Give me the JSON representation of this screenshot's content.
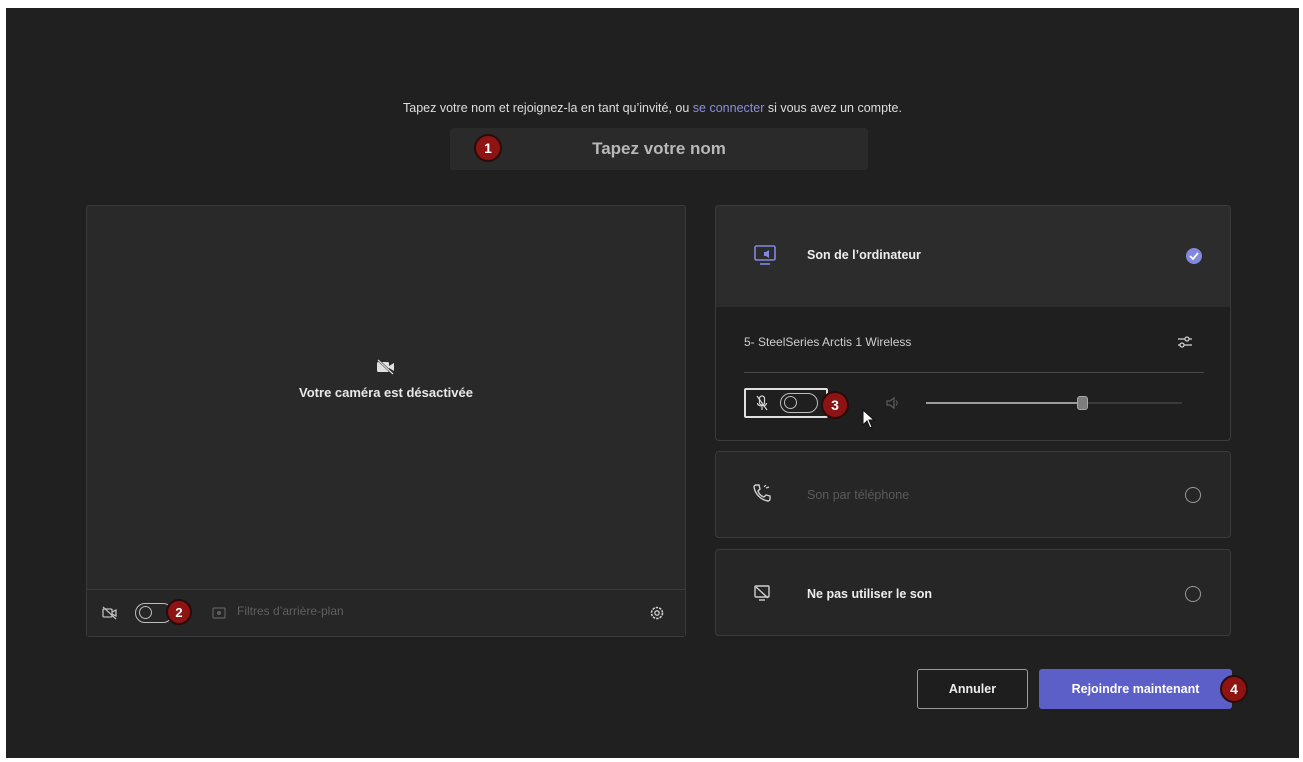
{
  "intro": {
    "before_link": "Tapez votre nom et rejoignez-la en tant qu’invité, ou ",
    "link": "se connecter",
    "after_link": " si vous avez un compte."
  },
  "name_field": {
    "placeholder": "Tapez votre nom",
    "value": ""
  },
  "video": {
    "status": "Votre caméra est désactivée",
    "camera_toggle_on": false,
    "filters_label": "Filtres d’arrière-plan"
  },
  "audio": {
    "computer_option": {
      "label": "Son de l’ordinateur",
      "selected": true
    },
    "device_name": "5- SteelSeries Arctis 1 Wireless",
    "mic_toggle_on": false,
    "speaker_volume": 0.61,
    "phone_option": {
      "label": "Son par téléphone",
      "selected": false,
      "disabled": true
    },
    "no_audio_option": {
      "label": "Ne pas utiliser le son",
      "selected": false
    }
  },
  "actions": {
    "cancel": "Annuler",
    "join": "Rejoindre maintenant"
  },
  "callouts": {
    "one": "1",
    "two": "2",
    "three": "3",
    "four": "4"
  },
  "colors": {
    "accent": "#5b5fc7",
    "background": "#202020",
    "callout": "#8e1313",
    "link": "#8b8fd8"
  },
  "icons": {
    "camera_off": "camera-off-icon",
    "settings": "gear-icon",
    "computer_audio": "computer-audio-icon",
    "device_settings": "sliders-icon",
    "mic_off": "mic-off-icon",
    "speaker": "speaker-icon",
    "phone": "phone-icon",
    "no_audio": "no-audio-icon",
    "cursor": "mouse-cursor-icon"
  }
}
